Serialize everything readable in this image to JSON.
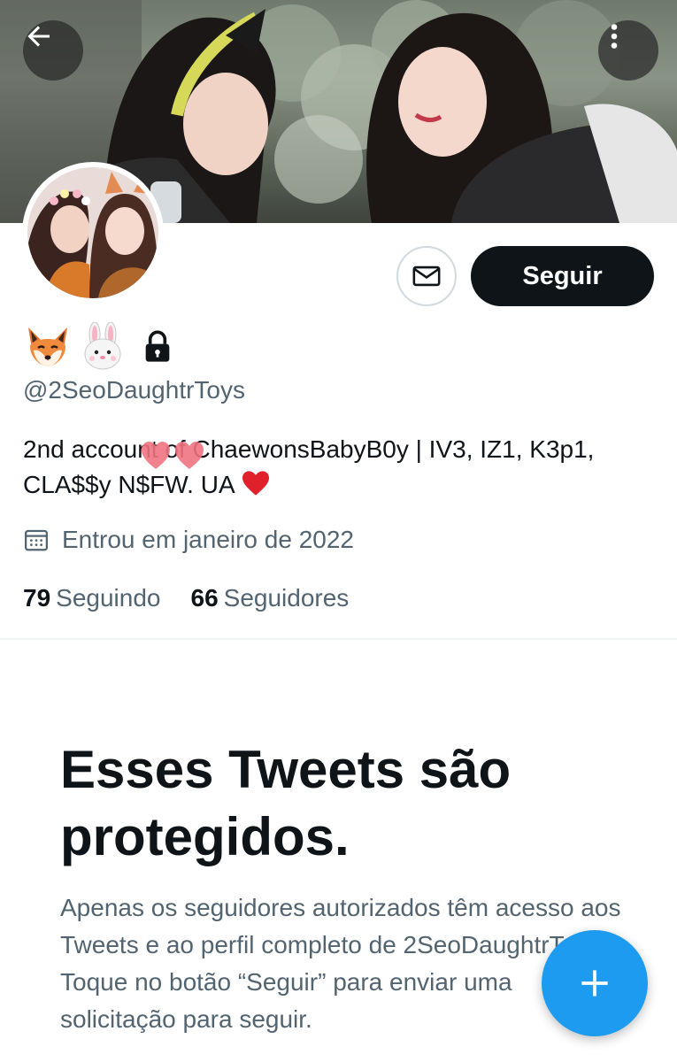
{
  "header": {
    "back_icon": "arrow-left-icon",
    "more_icon": "more-vertical-icon"
  },
  "actions": {
    "message_icon": "envelope-icon",
    "follow_label": "Seguir"
  },
  "profile": {
    "name_emojis": [
      "fox-face-icon",
      "rabbit-face-icon"
    ],
    "protected_icon": "lock-icon",
    "handle": "@2SeoDaughtrToys",
    "bio": "2nd account of ChaewonsBabyB0y | IV3, IZ1, K3p1, CLA$$y N$FW. UA",
    "bio_heart": "red-heart-icon",
    "joined": "Entrou em janeiro de 2022",
    "following_count": "79",
    "following_label": "Seguindo",
    "followers_count": "66",
    "followers_label": "Seguidores"
  },
  "protected": {
    "title": "Esses Tweets são protegidos.",
    "description": "Apenas os seguidores autorizados têm acesso aos Tweets e ao perfil completo de 2SeoDaughtrToys. Toque no botão “Seguir” para enviar uma solicitação para seguir."
  },
  "fab": {
    "icon": "plus-icon"
  },
  "colors": {
    "primary_text": "#0f1419",
    "secondary_text": "#536471",
    "accent": "#1d9bf0",
    "follow_button": "#0f1419"
  }
}
